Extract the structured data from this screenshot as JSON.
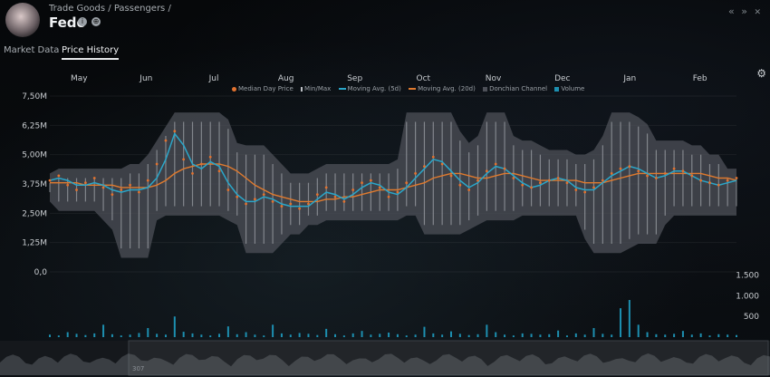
{
  "header": {
    "breadcrumb": "Trade Goods / Passengers /",
    "title": "Fedo",
    "info_icon": "info-icon",
    "cargo_icon": "cargo-icon",
    "back_icon": "double-chevron-left-icon",
    "forward_icon": "double-chevron-right-icon"
  },
  "tabs": [
    {
      "label": "Market Data",
      "active": false
    },
    {
      "label": "Price History",
      "active": true
    }
  ],
  "colors": {
    "median": "#e2722f",
    "ma5": "#2aa6c9",
    "ma20": "#e07a2e",
    "donchian": "#4d5058",
    "minmax": "#bcbfc4",
    "volume": "#1d8fb0"
  },
  "chart_data": {
    "type": "line",
    "months": [
      "May",
      "Jun",
      "Jul",
      "Aug",
      "Sep",
      "Oct",
      "Nov",
      "Dec",
      "Jan",
      "Feb"
    ],
    "legend": [
      "Median Day Price",
      "Min/Max",
      "Moving Avg. (5d)",
      "Moving Avg. (20d)",
      "Donchian Channel",
      "Volume"
    ],
    "y_ticks": [
      "7,50M",
      "6,25M",
      "5,00M",
      "3,75M",
      "2,50M",
      "1,25M",
      "0,0"
    ],
    "ylim": [
      0,
      7500000
    ],
    "volume_ticks": [
      "1.500",
      "1.000",
      "500"
    ],
    "volume_ylim": [
      0,
      1800
    ],
    "navigator_label": "307",
    "median": [
      3.9,
      4.1,
      3.7,
      3.5,
      3.8,
      4.0,
      3.6,
      3.3,
      3.5,
      3.7,
      3.4,
      3.9,
      4.6,
      5.6,
      6.0,
      4.8,
      4.2,
      4.6,
      4.9,
      4.3,
      3.5,
      3.2,
      2.9,
      3.1,
      3.3,
      3.0,
      2.8,
      2.9,
      2.7,
      2.9,
      3.3,
      3.6,
      3.2,
      3.0,
      3.5,
      3.8,
      3.9,
      3.6,
      3.2,
      3.4,
      3.8,
      4.2,
      4.5,
      4.9,
      4.6,
      4.1,
      3.7,
      3.5,
      3.9,
      4.3,
      4.6,
      4.4,
      4.0,
      3.7,
      3.6,
      3.8,
      3.9,
      4.0,
      3.8,
      3.5,
      3.4,
      3.6,
      3.9,
      4.2,
      4.4,
      4.5,
      4.3,
      4.1,
      4.0,
      4.2,
      4.4,
      4.3,
      4.1,
      3.9,
      3.8,
      3.7,
      3.9,
      4.0
    ],
    "ma5": [
      3.9,
      4.0,
      3.9,
      3.7,
      3.7,
      3.8,
      3.7,
      3.5,
      3.4,
      3.5,
      3.5,
      3.6,
      4.0,
      4.8,
      5.9,
      5.4,
      4.6,
      4.4,
      4.7,
      4.5,
      3.8,
      3.3,
      3.0,
      3.0,
      3.2,
      3.1,
      2.9,
      2.8,
      2.8,
      2.8,
      3.1,
      3.4,
      3.3,
      3.1,
      3.3,
      3.6,
      3.8,
      3.7,
      3.4,
      3.3,
      3.6,
      4.0,
      4.4,
      4.8,
      4.7,
      4.3,
      3.9,
      3.6,
      3.8,
      4.2,
      4.5,
      4.4,
      4.1,
      3.8,
      3.6,
      3.7,
      3.9,
      4.0,
      3.9,
      3.6,
      3.5,
      3.5,
      3.8,
      4.1,
      4.3,
      4.5,
      4.4,
      4.2,
      4.0,
      4.1,
      4.3,
      4.3,
      4.1,
      3.9,
      3.8,
      3.7,
      3.8,
      3.9
    ],
    "ma20": [
      3.8,
      3.8,
      3.8,
      3.8,
      3.7,
      3.7,
      3.7,
      3.7,
      3.6,
      3.6,
      3.6,
      3.6,
      3.7,
      3.9,
      4.2,
      4.4,
      4.5,
      4.6,
      4.6,
      4.6,
      4.5,
      4.3,
      4.0,
      3.7,
      3.5,
      3.3,
      3.2,
      3.1,
      3.0,
      3.0,
      3.0,
      3.1,
      3.1,
      3.2,
      3.2,
      3.3,
      3.4,
      3.5,
      3.5,
      3.5,
      3.6,
      3.7,
      3.8,
      4.0,
      4.1,
      4.2,
      4.2,
      4.1,
      4.0,
      4.0,
      4.1,
      4.2,
      4.2,
      4.1,
      4.0,
      3.9,
      3.9,
      3.9,
      3.9,
      3.9,
      3.8,
      3.8,
      3.8,
      3.9,
      4.0,
      4.1,
      4.2,
      4.2,
      4.2,
      4.2,
      4.2,
      4.2,
      4.2,
      4.2,
      4.1,
      4.0,
      4.0,
      3.9
    ],
    "donchian_high": [
      4.2,
      4.4,
      4.4,
      4.4,
      4.4,
      4.4,
      4.4,
      4.4,
      4.4,
      4.6,
      4.6,
      5.0,
      5.6,
      6.2,
      6.8,
      6.8,
      6.8,
      6.8,
      6.8,
      6.8,
      6.5,
      5.5,
      5.4,
      5.4,
      5.4,
      5.0,
      4.6,
      4.2,
      4.2,
      4.2,
      4.4,
      4.6,
      4.6,
      4.6,
      4.6,
      4.6,
      4.6,
      4.6,
      4.6,
      4.8,
      6.8,
      6.8,
      6.8,
      6.8,
      6.8,
      6.8,
      6.0,
      5.5,
      5.8,
      6.8,
      6.8,
      6.8,
      5.8,
      5.6,
      5.6,
      5.4,
      5.2,
      5.2,
      5.2,
      5.0,
      5.0,
      5.2,
      5.8,
      6.8,
      6.8,
      6.8,
      6.6,
      6.3,
      5.6,
      5.6,
      5.6,
      5.6,
      5.4,
      5.4,
      5.0,
      5.0,
      4.4,
      4.4
    ],
    "donchian_low": [
      3.0,
      2.6,
      2.6,
      2.6,
      2.6,
      2.6,
      2.2,
      1.8,
      0.6,
      0.6,
      0.6,
      0.6,
      2.2,
      2.4,
      2.4,
      2.4,
      2.4,
      2.4,
      2.4,
      2.4,
      2.2,
      2.0,
      0.8,
      0.8,
      0.8,
      0.8,
      1.2,
      1.6,
      1.6,
      2.0,
      2.0,
      2.2,
      2.2,
      2.2,
      2.2,
      2.2,
      2.2,
      2.2,
      2.2,
      2.2,
      2.4,
      2.4,
      1.6,
      1.6,
      1.6,
      1.6,
      1.6,
      1.8,
      2.0,
      2.2,
      2.2,
      2.2,
      2.2,
      2.4,
      2.4,
      2.4,
      2.4,
      2.4,
      2.4,
      2.4,
      1.4,
      0.8,
      0.8,
      0.8,
      0.8,
      1.0,
      1.2,
      1.2,
      1.2,
      2.0,
      2.4,
      2.4,
      2.4,
      2.4,
      2.4,
      2.4,
      2.4,
      2.4
    ],
    "volume": [
      60,
      40,
      120,
      80,
      50,
      90,
      300,
      70,
      40,
      60,
      100,
      220,
      80,
      60,
      500,
      130,
      90,
      60,
      40,
      80,
      260,
      70,
      120,
      60,
      40,
      300,
      90,
      60,
      100,
      80,
      50,
      200,
      70,
      40,
      90,
      150,
      60,
      80,
      110,
      70,
      40,
      60,
      250,
      90,
      60,
      140,
      80,
      50,
      70,
      300,
      120,
      60,
      40,
      90,
      80,
      60,
      70,
      160,
      40,
      90,
      60,
      220,
      80,
      60,
      700,
      900,
      300,
      120,
      70,
      60,
      80,
      150,
      60,
      90,
      40,
      70,
      60,
      50
    ]
  }
}
